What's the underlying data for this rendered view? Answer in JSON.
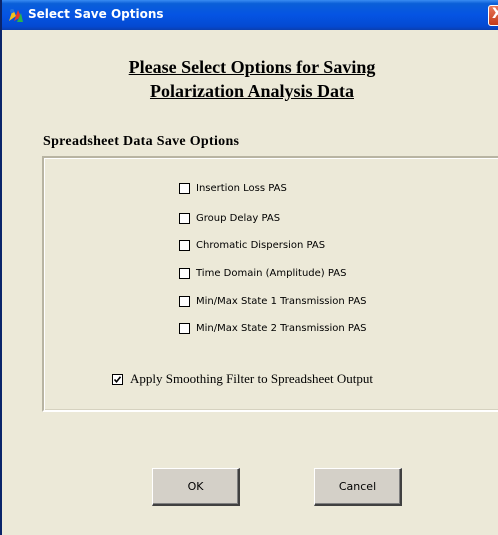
{
  "window": {
    "title": "Select Save Options",
    "close_glyph": "X"
  },
  "heading": {
    "line1": "Please Select Options for Saving",
    "line2": "Polarization Analysis Data"
  },
  "section": {
    "label": "Spreadsheet Data Save Options"
  },
  "options": [
    {
      "label": "Insertion Loss PAS",
      "checked": false
    },
    {
      "label": "Group Delay PAS",
      "checked": false
    },
    {
      "label": "Chromatic Dispersion PAS",
      "checked": false
    },
    {
      "label": "Time Domain (Amplitude) PAS",
      "checked": false
    },
    {
      "label": "Min/Max State 1 Transmission PAS",
      "checked": false
    },
    {
      "label": "Min/Max State 2 Transmission PAS",
      "checked": false
    }
  ],
  "smoothing": {
    "label": "Apply Smoothing Filter to Spreadsheet Output",
    "checked": true
  },
  "buttons": {
    "ok_label": "OK",
    "cancel_label": "Cancel"
  },
  "colors": {
    "titlebar": "#0554e3",
    "dialog_background": "#ece9d8",
    "button_face": "#d4d0c8",
    "close_button": "#c43a1a"
  },
  "icons": {
    "app": "app-icon",
    "close": "close-icon"
  }
}
